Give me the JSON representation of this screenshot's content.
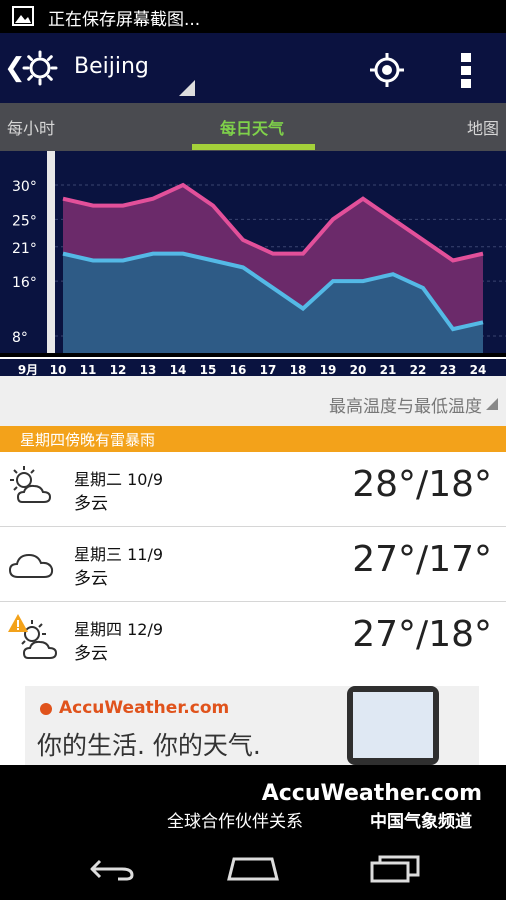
{
  "status_bar": {
    "text": "正在保存屏幕截图..."
  },
  "app_bar": {
    "back_glyph": "❮",
    "city": "Beijing"
  },
  "tabs": [
    {
      "label": "每小时",
      "active": false
    },
    {
      "label": "每日天气",
      "active": true
    },
    {
      "label": "地图",
      "active": false
    }
  ],
  "chart_data": {
    "type": "area",
    "x": [
      "9月",
      "10",
      "11",
      "12",
      "13",
      "14",
      "15",
      "16",
      "17",
      "18",
      "19",
      "20",
      "21",
      "22",
      "23",
      "24"
    ],
    "y_ticks": [
      "30°",
      "25°",
      "21°",
      "16°",
      "8°"
    ],
    "series": [
      {
        "values": [
          28,
          27,
          27,
          28,
          30,
          27,
          22,
          20,
          20,
          25,
          28,
          25,
          22,
          19,
          20
        ]
      },
      {
        "values": [
          20,
          19,
          19,
          20,
          20,
          19,
          18,
          15,
          12,
          16,
          16,
          17,
          15,
          9,
          10
        ]
      }
    ],
    "colors": {
      "high": "#e2509a",
      "low": "#54b9e6",
      "bg": "#0a1340",
      "high_fill": "#6b2a6a",
      "low_fill": "#2e5b86"
    }
  },
  "legend": {
    "label": "最高温度与最低温度"
  },
  "alert": {
    "text": "星期四傍晚有雷暴雨"
  },
  "forecast": [
    {
      "icon": "partly-cloudy-icon",
      "date": "星期二 10/9",
      "condition": "多云",
      "temps": "28°/18°"
    },
    {
      "icon": "cloud-icon",
      "date": "星期三 11/9",
      "condition": "多云",
      "temps": "27°/17°"
    },
    {
      "icon": "warning-partly-cloudy-icon",
      "date": "星期四 12/9",
      "condition": "多云",
      "temps": "27°/18°"
    }
  ],
  "ad": {
    "brand": "AccuWeather.com",
    "slogan": "你的生活. 你的天气."
  },
  "partner": {
    "brand": "AccuWeather.com",
    "text": "全球合作伙伴关系",
    "cma": "中国气象频道"
  }
}
